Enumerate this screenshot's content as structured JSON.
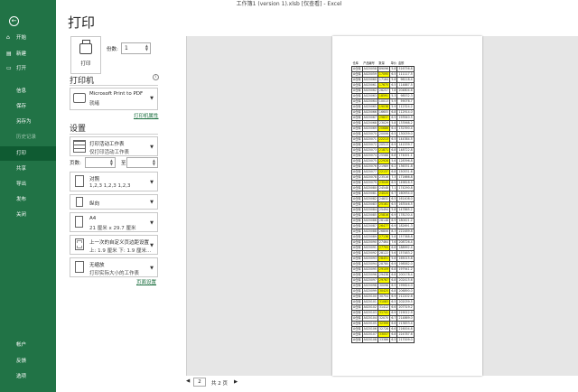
{
  "window": {
    "title": "工作簿1 (version 1).xlsb [仅查看] - Excel"
  },
  "sidebar": {
    "back_icon": "back-arrow-icon",
    "items": [
      {
        "label": "开始",
        "icon": "⌂"
      },
      {
        "label": "新建",
        "icon": "▤"
      },
      {
        "label": "打开",
        "icon": "▭"
      },
      {
        "label": "信息",
        "icon": ""
      },
      {
        "label": "保存",
        "icon": ""
      },
      {
        "label": "另存为",
        "icon": ""
      },
      {
        "label": "历史记录",
        "icon": ""
      },
      {
        "label": "打印",
        "icon": ""
      },
      {
        "label": "共享",
        "icon": ""
      },
      {
        "label": "导出",
        "icon": ""
      },
      {
        "label": "发布",
        "icon": ""
      },
      {
        "label": "关闭",
        "icon": ""
      }
    ],
    "bottom": [
      {
        "label": "帐户"
      },
      {
        "label": "反馈"
      },
      {
        "label": "选项"
      }
    ]
  },
  "print": {
    "title": "打印",
    "button": "打印",
    "copies_label": "份数:",
    "copies_value": "1",
    "printer_heading": "打印机",
    "printer_name": "Microsoft Print to PDF",
    "printer_status": "就绪",
    "printer_props": "打印机属性",
    "settings_heading": "设置",
    "what_1": "打印活动工作表",
    "what_2": "仅打印活动工作表",
    "pages_label": "页数:",
    "to_label": "至",
    "collate_1": "对照",
    "collate_2": "1,2,3    1,2,3    1,2,3",
    "orient": "纵向",
    "paper_1": "A4",
    "paper_2": "21 厘米 x 29.7 厘米",
    "margin_1": "上一次的自定义页边距设置",
    "margin_2": "上: 1.9 厘米 下: 1.9 厘米...",
    "scale_1": "无缩放",
    "scale_2": "打印实际大小的工作表",
    "page_setup": "页面设置"
  },
  "pager": {
    "current": "2",
    "total": "共 2 页"
  },
  "sheet": {
    "headers": [
      "仓库",
      "产品编号",
      "数量",
      "单价",
      "金额"
    ],
    "rows": [
      [
        "A仓库",
        "A020058",
        "89096",
        "5.8",
        "516756.8",
        0
      ],
      [
        "A仓库",
        "A020059",
        "17095",
        "6.5",
        "111117.5",
        1
      ],
      [
        "A仓库",
        "A020060",
        "17164",
        "5.6",
        "96118.4",
        0
      ],
      [
        "A仓库",
        "A020061",
        "17675",
        "6.5",
        "114887.5",
        1
      ],
      [
        "A仓库",
        "A020062",
        "26257",
        "7.8",
        "204804.6",
        0
      ],
      [
        "A仓库",
        "A020063",
        "18591",
        "5.3",
        "98532.3",
        1
      ],
      [
        "A仓库",
        "A020064",
        "10013",
        "5.9",
        "59076.7",
        0
      ],
      [
        "A仓库",
        "A020065",
        "19038",
        "5.9",
        "112324.2",
        1
      ],
      [
        "A仓库",
        "A020066",
        "16605",
        "6.8",
        "112914.0",
        0
      ],
      [
        "A仓库",
        "A020067",
        "29837",
        "6.5",
        "193940.5",
        1
      ],
      [
        "A仓库",
        "A020068",
        "23029",
        "5.8",
        "133568.2",
        0
      ],
      [
        "A仓库",
        "A020069",
        "20686",
        "6.4",
        "132390.4",
        1
      ],
      [
        "A仓库",
        "A020070",
        "20006",
        "6.5",
        "130039.0",
        0
      ],
      [
        "A仓库",
        "A020071",
        "22213",
        "6.5",
        "144384.5",
        1
      ],
      [
        "A仓库",
        "A020072",
        "20513",
        "6.9",
        "141539.7",
        0
      ],
      [
        "A仓库",
        "A020073",
        "21871",
        "6.8",
        "148722.8",
        1
      ],
      [
        "A仓库",
        "A020074",
        "25588",
        "6.8",
        "174001.1",
        0
      ],
      [
        "A仓库",
        "A020075",
        "22928",
        "5.6",
        "128396.8",
        1
      ],
      [
        "A仓库",
        "A020076",
        "21989",
        "6.2",
        "136331.8",
        0
      ],
      [
        "A仓库",
        "A020077",
        "22137",
        "6.8",
        "150531.6",
        1
      ],
      [
        "A仓库",
        "A020078",
        "23516",
        "7.3",
        "171666.8",
        0
      ],
      [
        "A仓库",
        "A020079",
        "23049",
        "6.5",
        "149818.5",
        1
      ],
      [
        "A仓库",
        "A020080",
        "24548",
        "7.1",
        "174290.8",
        0
      ],
      [
        "A仓库",
        "A020081",
        "24020",
        "6.7",
        "160934.0",
        1
      ],
      [
        "A仓库",
        "A020082",
        "24832",
        "6.5",
        "161408.0",
        0
      ],
      [
        "A仓库",
        "A020083",
        "25161",
        "6.5",
        "163546.5",
        1
      ],
      [
        "A仓库",
        "A020084",
        "25494",
        "5.8",
        "147865.2",
        0
      ],
      [
        "A仓库",
        "A020085",
        "25816",
        "6.9",
        "178130.4",
        1
      ],
      [
        "A仓库",
        "A020086",
        "26148",
        "6.9",
        "180421.2",
        0
      ],
      [
        "A仓库",
        "A020087",
        "26477",
        "6.9",
        "182691.3",
        1
      ],
      [
        "A仓库",
        "A020088",
        "26806",
        "8.3",
        "222489.8",
        0
      ],
      [
        "A仓库",
        "A020089",
        "27136",
        "5.8",
        "157388.8",
        1
      ],
      [
        "A仓库",
        "A020090",
        "27464",
        "7.6",
        "208726.4",
        0
      ],
      [
        "A仓库",
        "A020091",
        "27793",
        "6.8",
        "188992.4",
        1
      ],
      [
        "A仓库",
        "A020092",
        "28122",
        "5.6",
        "157483.2",
        0
      ],
      [
        "A仓库",
        "A020093",
        "28451",
        "5.8",
        "165015.8",
        1
      ],
      [
        "A仓库",
        "A020094",
        "28780",
        "6.9",
        "198582.0",
        0
      ],
      [
        "A仓库",
        "A020095",
        "29109",
        "6.8",
        "197941.2",
        1
      ],
      [
        "A仓库",
        "A020096",
        "29438",
        "6.8",
        "200178.4",
        0
      ],
      [
        "A仓库",
        "A020097",
        "29767",
        "6.8",
        "202415.6",
        1
      ],
      [
        "A仓库",
        "A020098",
        "30096",
        "6.5",
        "195624.0",
        0
      ],
      [
        "A仓库",
        "A020099",
        "30425",
        "6.8",
        "206890.0",
        1
      ],
      [
        "A仓库",
        "A020100",
        "30754",
        "6.9",
        "212202.6",
        0
      ],
      [
        "A仓库",
        "A020101",
        "31083",
        "6.5",
        "202039.5",
        1
      ],
      [
        "A仓库",
        "A020102",
        "31412",
        "6.6",
        "207319.2",
        0
      ],
      [
        "A仓库",
        "A020103",
        "31741",
        "6.9",
        "219012.9",
        1
      ],
      [
        "A仓库",
        "A020104",
        "32070",
        "6.7",
        "214869.0",
        0
      ],
      [
        "A仓库",
        "A020105",
        "32399",
        "6.6",
        "213833.4",
        1
      ],
      [
        "A仓库",
        "A020106",
        "32728",
        "6.6",
        "216004.8",
        0
      ],
      [
        "A仓库",
        "A020107",
        "33057",
        "6.8",
        "224787.6",
        1
      ],
      [
        "A仓库",
        "A020108",
        "33386",
        "6.5",
        "217009.0",
        0
      ]
    ]
  }
}
